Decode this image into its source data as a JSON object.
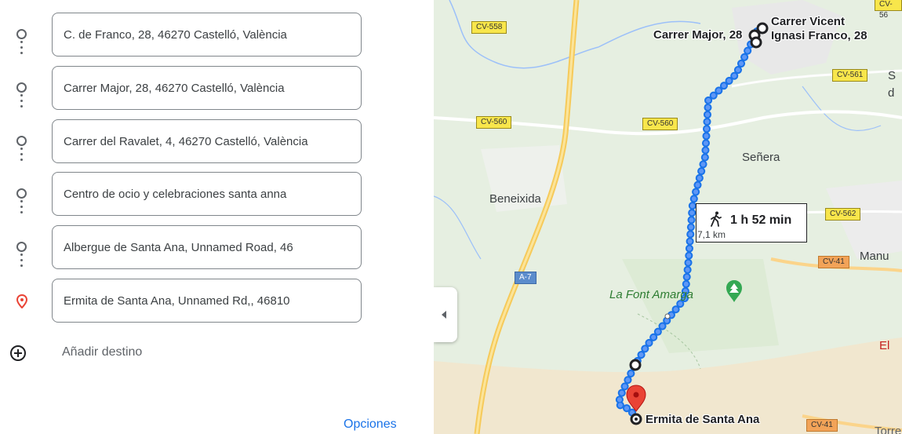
{
  "stops": [
    {
      "value": "C. de Franco, 28, 46270 Castelló, València",
      "marker": "circle-icon"
    },
    {
      "value": "Carrer Major, 28, 46270 Castelló, València",
      "marker": "circle-icon"
    },
    {
      "value": "Carrer del Ravalet, 4, 46270 Castelló, València",
      "marker": "circle-icon"
    },
    {
      "value": "Centro de ocio y celebraciones santa anna",
      "marker": "circle-icon"
    },
    {
      "value": "Albergue de Santa Ana, Unnamed Road, 46",
      "marker": "circle-icon"
    },
    {
      "value": "Ermita de Santa Ana, Unnamed Rd,, 46810",
      "marker": "location-pin-icon"
    }
  ],
  "add_destination": {
    "label": "Añadir destino",
    "icon": "plus-circle-icon"
  },
  "options_link": "Opciones",
  "map": {
    "road_shields": [
      {
        "text": "CV-558",
        "color": "yellow"
      },
      {
        "text": "CV-560",
        "color": "yellow"
      },
      {
        "text": "CV-560",
        "color": "yellow"
      },
      {
        "text": "CV-561",
        "color": "yellow"
      },
      {
        "text": "CV-562",
        "color": "yellow"
      },
      {
        "text": "CV-41",
        "color": "orange"
      },
      {
        "text": "CV-41",
        "color": "orange"
      },
      {
        "text": "A-7",
        "color": "blue"
      },
      {
        "text": "CV-56",
        "color": "yellow"
      }
    ],
    "place_labels": {
      "carrer_major": "Carrer Major, 28",
      "carrer_vicent_1": "Carrer Vicent",
      "carrer_vicent_2": "Ignasi Franco, 28",
      "senera": "Señera",
      "beneixida": "Beneixida",
      "font_amarga": "La Font Amarga",
      "manu": "Manu",
      "ermita": "Ermita de Santa Ana",
      "s_partial": "S",
      "d_partial": "d",
      "el_partial": "El",
      "torre_partial": "Torre"
    },
    "route_summary": {
      "time": "1 h 52 min",
      "distance": "7,1 km",
      "mode_icon": "walking-icon"
    },
    "colors": {
      "route": "#1a73e8",
      "pin": "#ea4335",
      "shield_yellow": "#f8e64b",
      "shield_orange": "#f2a358",
      "link": "#1a73e8"
    }
  }
}
